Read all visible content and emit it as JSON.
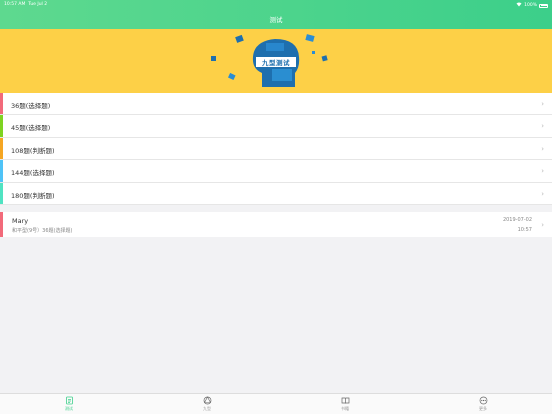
{
  "status_bar": {
    "time": "10:57 AM",
    "date": "Tue Jul 2",
    "battery": "100%"
  },
  "nav": {
    "title": "测试"
  },
  "banner": {
    "logo_text": "九型测试"
  },
  "tests": [
    {
      "label": "36题(选择题)",
      "color": "#f26a7a"
    },
    {
      "label": "45题(选择题)",
      "color": "#7ed321"
    },
    {
      "label": "108题(判断题)",
      "color": "#f5a623"
    },
    {
      "label": "144题(选择题)",
      "color": "#4fc3f7"
    },
    {
      "label": "180题(判断题)",
      "color": "#50e3c2"
    }
  ],
  "record": {
    "name": "Mary",
    "detail": "和平型(9号）36题(选择题)",
    "date": "2019-07-02",
    "time": "10:57"
  },
  "tabs": [
    {
      "label": "测试",
      "icon": "test-icon",
      "active": true
    },
    {
      "label": "九型",
      "icon": "enneagram-icon",
      "active": false
    },
    {
      "label": "书籍",
      "icon": "book-icon",
      "active": false
    },
    {
      "label": "更多",
      "icon": "more-icon",
      "active": false
    }
  ],
  "colors": {
    "accent": "#3ccf8a",
    "banner": "#fdd047",
    "puzzle": "#1e6fae"
  }
}
